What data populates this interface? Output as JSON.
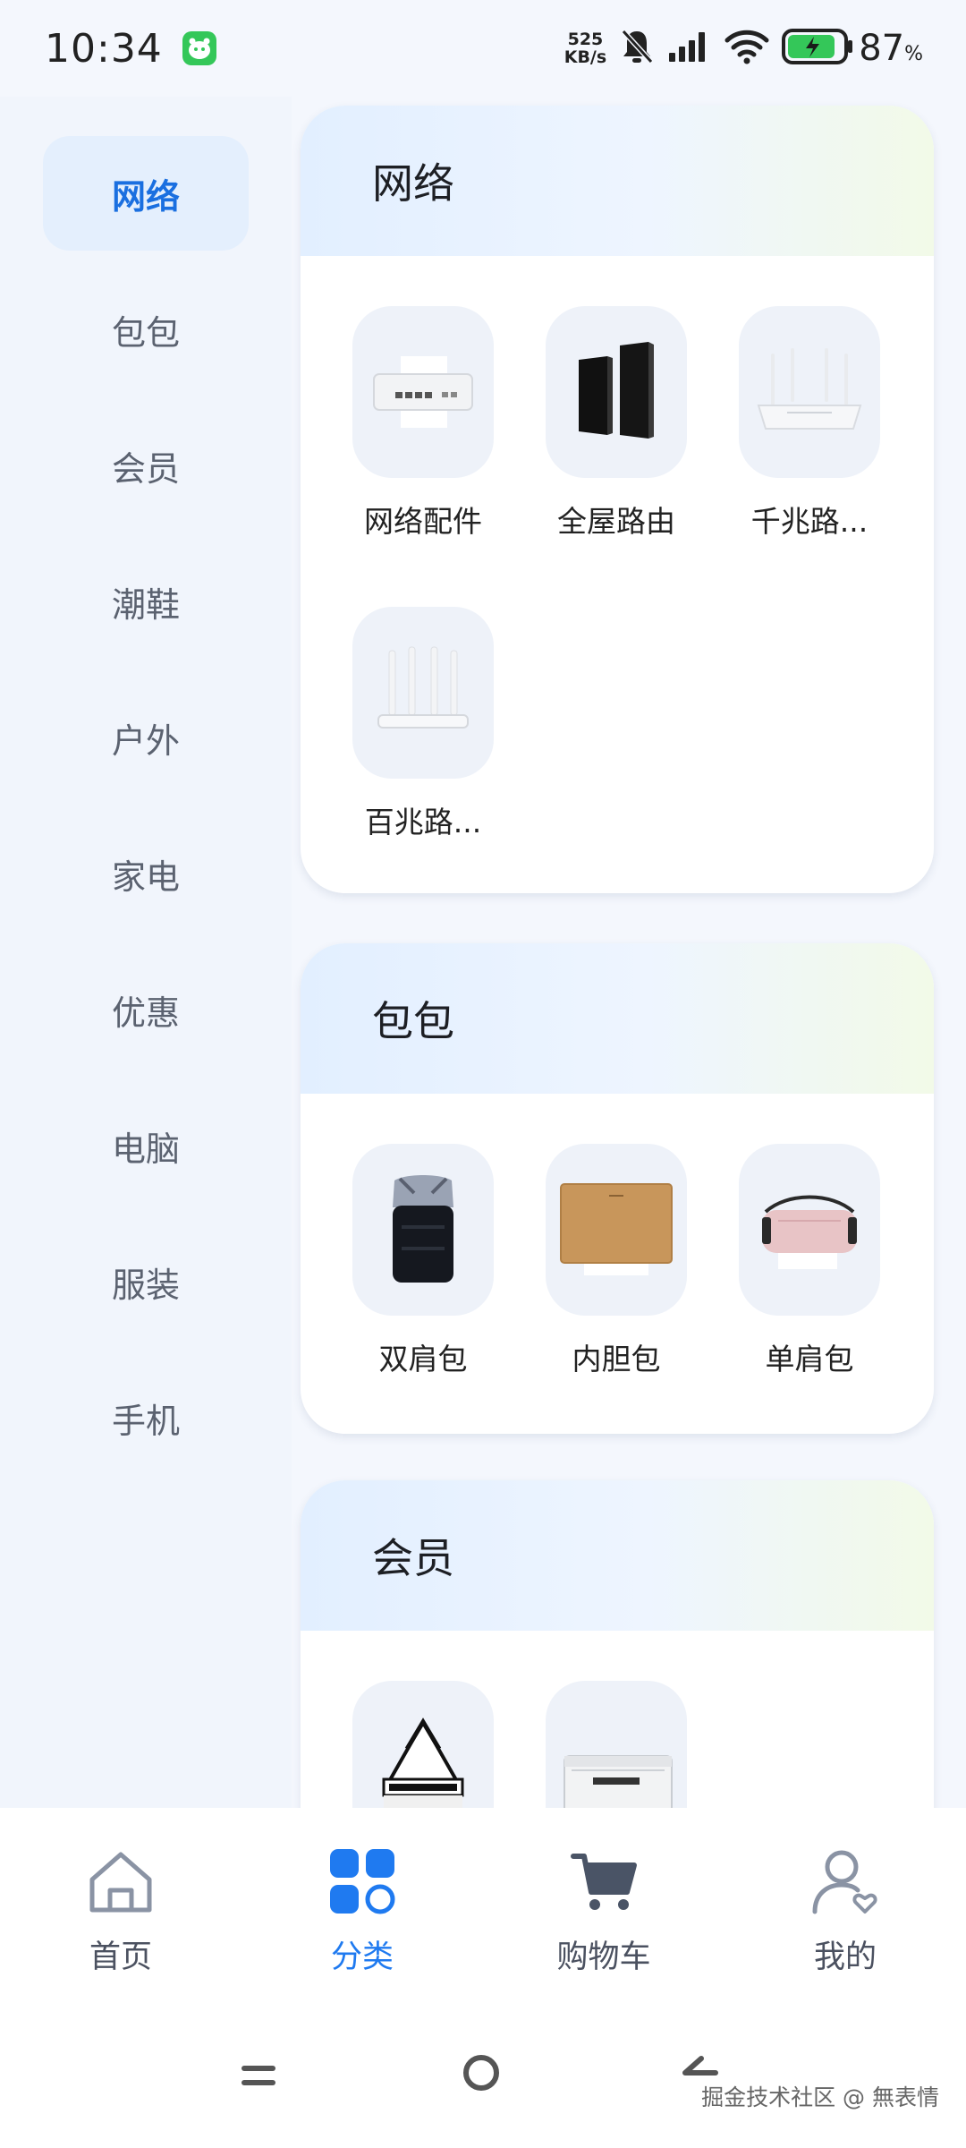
{
  "status_bar": {
    "time": "10:34",
    "net_speed_value": "525",
    "net_speed_unit": "KB/s",
    "battery_percent": "87",
    "battery_unit": "%"
  },
  "sidebar": {
    "items": [
      {
        "label": "网络",
        "active": true
      },
      {
        "label": "包包",
        "active": false
      },
      {
        "label": "会员",
        "active": false
      },
      {
        "label": "潮鞋",
        "active": false
      },
      {
        "label": "户外",
        "active": false
      },
      {
        "label": "家电",
        "active": false
      },
      {
        "label": "优惠",
        "active": false
      },
      {
        "label": "电脑",
        "active": false
      },
      {
        "label": "服装",
        "active": false
      },
      {
        "label": "手机",
        "active": false
      }
    ]
  },
  "sections": [
    {
      "title": "网络",
      "items": [
        {
          "label": "网络配件",
          "icon": "network-switch-image"
        },
        {
          "label": "全屋路由",
          "icon": "mesh-router-image"
        },
        {
          "label": "千兆路...",
          "icon": "gigabit-router-image"
        },
        {
          "label": "百兆路...",
          "icon": "router-image"
        }
      ]
    },
    {
      "title": "包包",
      "items": [
        {
          "label": "双肩包",
          "icon": "backpack-image"
        },
        {
          "label": "内胆包",
          "icon": "laptop-sleeve-image"
        },
        {
          "label": "单肩包",
          "icon": "shoulder-bag-image"
        }
      ]
    },
    {
      "title": "会员",
      "items": [
        {
          "label": "",
          "icon": "explore-tote-image"
        },
        {
          "label": "",
          "icon": "explore-storage-box-image"
        }
      ]
    }
  ],
  "bottom_nav": {
    "items": [
      {
        "label": "首页",
        "icon": "home-icon",
        "active": false
      },
      {
        "label": "分类",
        "icon": "category-icon",
        "active": true
      },
      {
        "label": "购物车",
        "icon": "cart-icon",
        "active": false
      },
      {
        "label": "我的",
        "icon": "profile-icon",
        "active": false
      }
    ]
  },
  "colors": {
    "accent": "#1f7af0",
    "sidebar_active_bg": "#e4effd",
    "battery_fill": "#34c759"
  },
  "watermark": "掘金技术社区 @ 無表情"
}
